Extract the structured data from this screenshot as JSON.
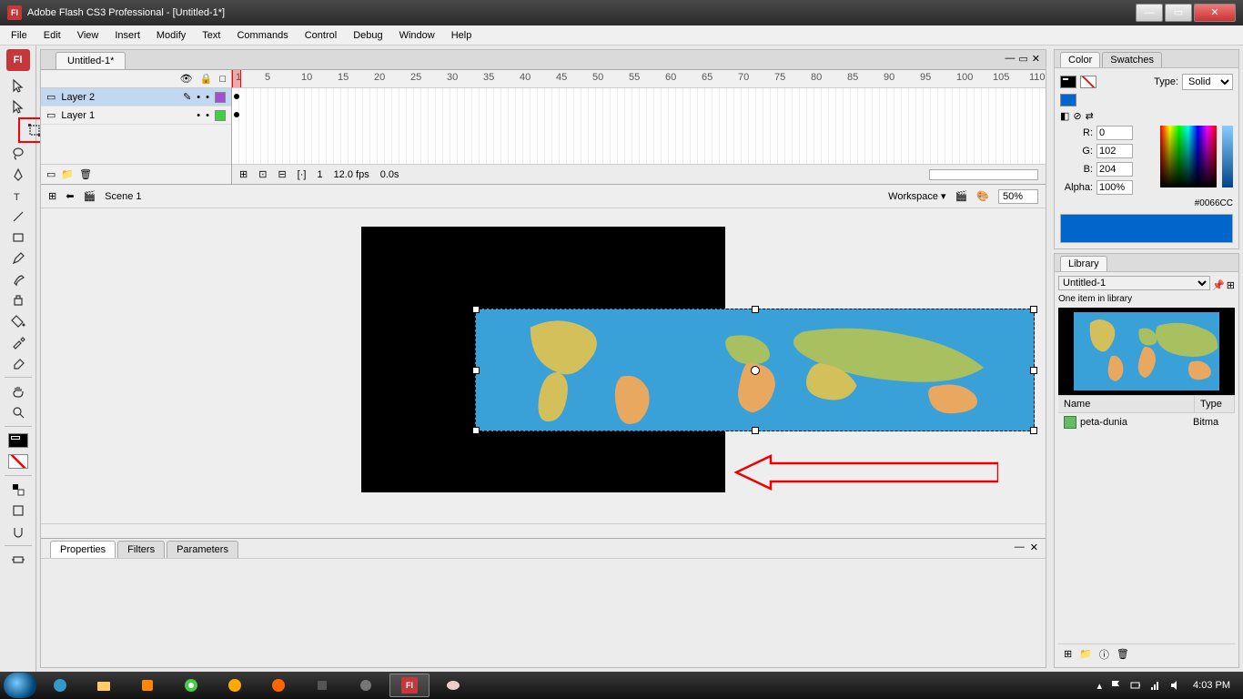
{
  "window": {
    "title": "Adobe Flash CS3 Professional - [Untitled-1*]"
  },
  "menu": [
    "File",
    "Edit",
    "View",
    "Insert",
    "Modify",
    "Text",
    "Commands",
    "Control",
    "Debug",
    "Window",
    "Help"
  ],
  "doc_tab": "Untitled-1*",
  "layers": [
    {
      "name": "Layer 2",
      "color": "#a050d0",
      "selected": true
    },
    {
      "name": "Layer 1",
      "color": "#40d040",
      "selected": false
    }
  ],
  "timeline": {
    "ticks": [
      1,
      5,
      10,
      15,
      20,
      25,
      30,
      35,
      40,
      45,
      50,
      55,
      60,
      65,
      70,
      75,
      80,
      85,
      90,
      95,
      100,
      105,
      110
    ],
    "status_frame": "1",
    "status_fps": "12.0 fps",
    "status_time": "0.0s"
  },
  "scene": {
    "label": "Scene 1",
    "workspace": "Workspace ▾",
    "zoom": "50%"
  },
  "properties": {
    "tabs": [
      "Properties",
      "Filters",
      "Parameters"
    ]
  },
  "color": {
    "tabs": [
      "Color",
      "Swatches"
    ],
    "type_label": "Type:",
    "type_value": "Solid",
    "r_label": "R:",
    "r": "0",
    "g_label": "G:",
    "g": "102",
    "b_label": "B:",
    "b": "204",
    "alpha_label": "Alpha:",
    "alpha": "100%",
    "hex": "#0066CC"
  },
  "library": {
    "tab": "Library",
    "doc": "Untitled-1",
    "count": "One item in library",
    "headers": {
      "name": "Name",
      "type": "Type"
    },
    "item_name": "peta-dunia",
    "item_type": "Bitma"
  },
  "taskbar": {
    "time": "4:03 PM"
  }
}
